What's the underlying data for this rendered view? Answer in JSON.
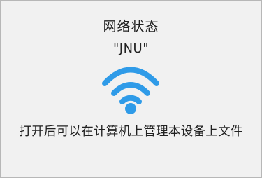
{
  "status": {
    "title": "网络状态",
    "ssid": "\"JNU\"",
    "hint": "打开后可以在计算机上管理本设备上文件",
    "wifi_icon": "wifi-icon",
    "accent_color": "#2f9be8"
  }
}
